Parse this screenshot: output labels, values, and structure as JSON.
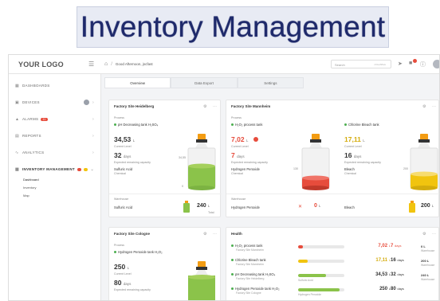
{
  "banner": {
    "title": "Inventory Management"
  },
  "topbar": {
    "logo": "YOUR LOGO",
    "greeting": "Good Afternoon, jscfast",
    "search_placeholder": "Search",
    "search_key": "ctrl+shift+k"
  },
  "sidebar": {
    "items": [
      {
        "label": "DASHBOARDS"
      },
      {
        "label": "DEVICES"
      },
      {
        "label": "ALARMS",
        "count": "11"
      },
      {
        "label": "REPORTS"
      },
      {
        "label": "ANALYTICS"
      },
      {
        "label": "INVENTORY MANAGEMENT"
      }
    ],
    "subitems": [
      "Dashboard",
      "Inventory",
      "Map"
    ]
  },
  "tabs": [
    "Overview",
    "Data Export",
    "Settings"
  ],
  "cards": {
    "heidelberg": {
      "title": "Factory Site Heidelberg",
      "section": "Process",
      "tank_name": "pH Decreasing tank H₂SO₄",
      "level": "34,53",
      "level_unit": "L",
      "level_label": "Current Level",
      "days": "32",
      "days_unit": "days",
      "days_label": "Expected remaining capacity",
      "chemical": "Sulfuric Acid",
      "chemical_label": "Chemical",
      "scale_top": "34,55",
      "scale_bottom": "0",
      "fill": 0.55,
      "warehouse_label": "Warehouse",
      "wh_chemical": "Sulfuric Acid",
      "wh_amount": "240",
      "wh_unit": "L",
      "wh_total_label": "Total"
    },
    "mannheim": {
      "title": "Factory Site Mannheim",
      "section": "Process",
      "tank1_name": "H₂O₂ process tank",
      "tank1_level": "7,02",
      "tank1_unit": "L",
      "tank1_level_label": "Current Level",
      "tank1_days": "7",
      "tank1_days_unit": "days",
      "tank1_days_label": "Expected remaining capacity",
      "tank1_chemical": "Hydrogen Peroxide",
      "tank1_chemical_label": "Chemical",
      "tank1_fill": 0.25,
      "tank1_scale_top": "130",
      "tank2_name": "Chlorine Bleach tank",
      "tank2_level": "17,11",
      "tank2_unit": "L",
      "tank2_level_label": "Current Level",
      "tank2_days": "16",
      "tank2_days_unit": "days",
      "tank2_days_label": "Expected remaining capacity",
      "tank2_chemical": "Bleach",
      "tank2_chemical_label": "Chemical",
      "tank2_fill": 0.35,
      "tank2_scale_top": "200",
      "warehouse_label": "Warehouse",
      "wh1_chemical": "Hydrogen Peroxide",
      "wh1_amount": "0",
      "wh1_unit": "L",
      "wh2_chemical": "Bleach",
      "wh2_amount": "200",
      "wh2_unit": "L"
    },
    "cologne": {
      "title": "Factory Site Cologne",
      "section": "Process",
      "tank_name": "Hydrogen Peroxide tank H₂O₂",
      "level": "250",
      "level_unit": "L",
      "level_label": "Current Level",
      "days": "80",
      "days_unit": "days",
      "days_label": "Expected remaining capacity"
    },
    "health": {
      "title": "Health",
      "rows": [
        {
          "name": "H₂O₂ process tank",
          "site": "Factory Site Mannheim",
          "fill": 0.1,
          "color": "#e74c3c",
          "chemical": "",
          "level": "7,02",
          "unit": "L",
          "days": "7",
          "days_unit": "days",
          "cap": "0 L",
          "cap_label": "Warehouse"
        },
        {
          "name": "Chlorine Bleach tank",
          "site": "Factory Site Mannheim",
          "fill": 0.2,
          "color": "#f1c40f",
          "chemical": "",
          "level": "17,11",
          "unit": "L",
          "days": "16",
          "days_unit": "days",
          "cap": "200 L",
          "cap_label": "Warehouse"
        },
        {
          "name": "pH Decreasing tank H₂SO₄",
          "site": "Factory Site Heidelberg",
          "fill": 0.6,
          "color": "#8bc34a",
          "chemical": "Sulfuric Acid",
          "level": "34,53",
          "unit": "L",
          "days": "32",
          "days_unit": "days",
          "cap": "240 L",
          "cap_label": "Warehouse"
        },
        {
          "name": "Hydrogen Peroxide tank H₂O₂",
          "site": "Factory Site Cologne",
          "fill": 0.9,
          "color": "#8bc34a",
          "chemical": "Hydrogen Peroxide",
          "level": "250",
          "unit": "L",
          "days": "80",
          "days_unit": "days",
          "cap": "",
          "cap_label": ""
        }
      ]
    }
  },
  "colors": {
    "accent": "#1f2a6b",
    "green": "#8bc34a",
    "red": "#e74c3c",
    "yellow": "#f1c40f",
    "cap_orange": "#f39c12"
  }
}
